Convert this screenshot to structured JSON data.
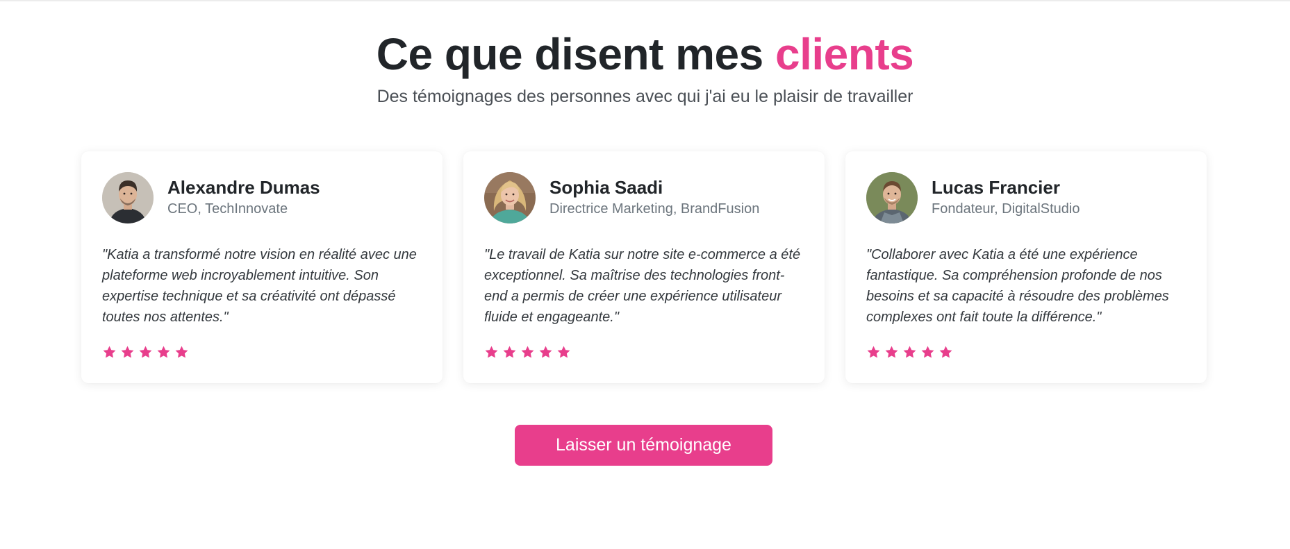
{
  "section": {
    "title_part1": "Ce que disent mes ",
    "title_accent": "clients",
    "subtitle": "Des témoignages des personnes avec qui j'ai eu le plaisir de travailler"
  },
  "colors": {
    "accent": "#e83e8c",
    "text_dark": "#212529",
    "text_muted": "#6c757d"
  },
  "testimonials": [
    {
      "name": "Alexandre Dumas",
      "role": "CEO, TechInnovate",
      "quote": "\"Katia a transformé notre vision en réalité avec une plateforme web incroyablement intuitive. Son expertise technique et sa créativité ont dépassé toutes nos attentes.\"",
      "rating": 5,
      "avatar": "avatar-photo"
    },
    {
      "name": "Sophia Saadi",
      "role": "Directrice Marketing, BrandFusion",
      "quote": "\"Le travail de Katia sur notre site e-commerce a été exceptionnel. Sa maîtrise des technologies front-end a permis de créer une expérience utilisateur fluide et engageante.\"",
      "rating": 5,
      "avatar": "avatar-photo"
    },
    {
      "name": "Lucas Francier",
      "role": "Fondateur, DigitalStudio",
      "quote": "\"Collaborer avec Katia a été une expérience fantastique. Sa compréhension profonde de nos besoins et sa capacité à résoudre des problèmes complexes ont fait toute la différence.\"",
      "rating": 5,
      "avatar": "avatar-photo"
    }
  ],
  "cta": {
    "label": "Laisser un témoignage"
  }
}
